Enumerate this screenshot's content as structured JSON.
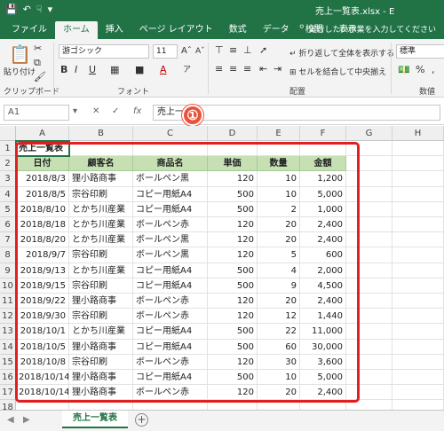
{
  "window": {
    "title": "売上一覧表.xlsx - E",
    "qat_icons": [
      "save-icon",
      "undo-icon",
      "touch-mode-icon",
      "customize-qat-icon"
    ]
  },
  "ribbon": {
    "tabs": [
      {
        "label": "ファイル",
        "active": false
      },
      {
        "label": "ホーム",
        "active": true
      },
      {
        "label": "挿入",
        "active": false
      },
      {
        "label": "ページ レイアウト",
        "active": false
      },
      {
        "label": "数式",
        "active": false
      },
      {
        "label": "データ",
        "active": false
      },
      {
        "label": "校閲",
        "active": false
      },
      {
        "label": "表示",
        "active": false
      }
    ],
    "tell_me": "実行したい作業を入力してください",
    "clipboard": {
      "paste_label": "貼り付け",
      "group_label": "クリップボード"
    },
    "font": {
      "name": "游ゴシック",
      "size": "11",
      "group_label": "フォント"
    },
    "alignment": {
      "wrap_text": "折り返して全体を表示する",
      "merge_center": "セルを結合して中央揃え",
      "group_label": "配置"
    },
    "number": {
      "format": "標準",
      "group_label": "数値",
      "percent": "%",
      "comma": ","
    }
  },
  "formula_bar": {
    "name_box": "A1",
    "fx": "fx",
    "value": "売上一"
  },
  "annotation": {
    "badge": "①"
  },
  "grid": {
    "columns": [
      "A",
      "B",
      "C",
      "D",
      "E",
      "F",
      "G",
      "H"
    ],
    "rows": [
      "1",
      "2",
      "3",
      "4",
      "5",
      "6",
      "7",
      "8",
      "9",
      "10",
      "11",
      "12",
      "13",
      "14",
      "15",
      "16",
      "17",
      "18"
    ],
    "sheet_title": "売上一覧表",
    "headers": [
      "日付",
      "顧客名",
      "商品名",
      "単価",
      "数量",
      "金額"
    ],
    "data": [
      [
        "2018/8/3",
        "狸小路商事",
        "ボールペン黒",
        "120",
        "10",
        "1,200"
      ],
      [
        "2018/8/5",
        "宗谷印刷",
        "コピー用紙A4",
        "500",
        "10",
        "5,000"
      ],
      [
        "2018/8/10",
        "とかち川産業",
        "コピー用紙A4",
        "500",
        "2",
        "1,000"
      ],
      [
        "2018/8/18",
        "とかち川産業",
        "ボールペン赤",
        "120",
        "20",
        "2,400"
      ],
      [
        "2018/8/20",
        "とかち川産業",
        "ボールペン黒",
        "120",
        "20",
        "2,400"
      ],
      [
        "2018/9/7",
        "宗谷印刷",
        "ボールペン黒",
        "120",
        "5",
        "600"
      ],
      [
        "2018/9/13",
        "とかち川産業",
        "コピー用紙A4",
        "500",
        "4",
        "2,000"
      ],
      [
        "2018/9/15",
        "宗谷印刷",
        "コピー用紙A4",
        "500",
        "9",
        "4,500"
      ],
      [
        "2018/9/22",
        "狸小路商事",
        "ボールペン赤",
        "120",
        "20",
        "2,400"
      ],
      [
        "2018/9/30",
        "宗谷印刷",
        "ボールペン赤",
        "120",
        "12",
        "1,440"
      ],
      [
        "2018/10/1",
        "とかち川産業",
        "コピー用紙A4",
        "500",
        "22",
        "11,000"
      ],
      [
        "2018/10/5",
        "狸小路商事",
        "コピー用紙A4",
        "500",
        "60",
        "30,000"
      ],
      [
        "2018/10/8",
        "宗谷印刷",
        "ボールペン赤",
        "120",
        "30",
        "3,600"
      ],
      [
        "2018/10/14",
        "狸小路商事",
        "コピー用紙A4",
        "500",
        "10",
        "5,000"
      ],
      [
        "2018/10/14",
        "狸小路商事",
        "ボールペン赤",
        "120",
        "20",
        "2,400"
      ]
    ]
  },
  "sheet_tabs": {
    "active": "売上一覧表",
    "add": "+"
  },
  "colors": {
    "excel_green": "#217346",
    "header_fill": "#c6e0b4",
    "highlight_red": "#e02020",
    "badge_red": "#e9533b"
  }
}
